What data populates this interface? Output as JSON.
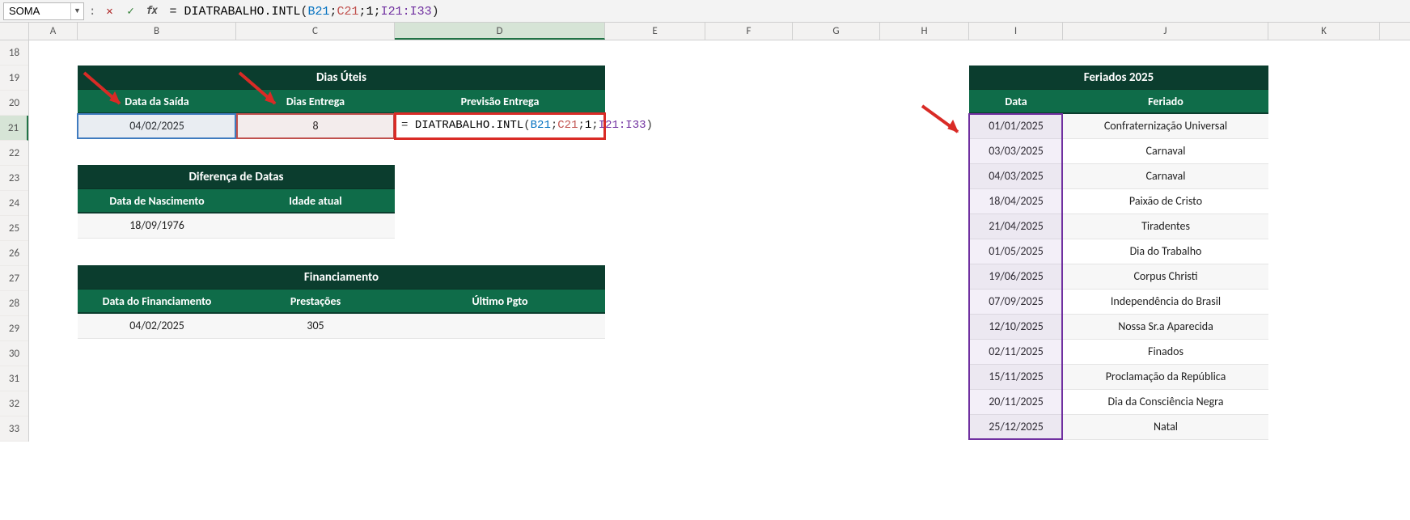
{
  "namebox_value": "SOMA",
  "formula": {
    "raw": "= DIATRABALHO.INTL(B21;C21;1;I21:I33)",
    "fn": "DIATRABALHO.INTL",
    "ref1": "B21",
    "ref2": "C21",
    "num": "1",
    "ref3": "I21:I33"
  },
  "cancel_glyph": "✕",
  "enter_glyph": "✓",
  "fx_glyph": "fx",
  "columns": [
    "A",
    "B",
    "C",
    "D",
    "E",
    "F",
    "G",
    "H",
    "I",
    "J",
    "K"
  ],
  "rows": [
    "18",
    "19",
    "20",
    "21",
    "22",
    "23",
    "24",
    "25",
    "26",
    "27",
    "28",
    "29",
    "30",
    "31",
    "32",
    "33"
  ],
  "dias_uteis": {
    "title": "Dias Úteis",
    "headers": {
      "b": "Data da Saída",
      "c": "Dias Entrega",
      "d": "Previsão Entrega"
    },
    "row": {
      "b": "04/02/2025",
      "c": "8",
      "d_formula": "= DIATRABALHO.INTL(B21;C21;1;I21:I33)"
    }
  },
  "diferenca": {
    "title": "Diferença de Datas",
    "headers": {
      "b": "Data de Nascimento",
      "c": "Idade atual"
    },
    "row": {
      "b": "18/09/1976",
      "c": ""
    }
  },
  "financiamento": {
    "title": "Financiamento",
    "headers": {
      "b": "Data do Financiamento",
      "c": "Prestações",
      "d": "Último Pgto"
    },
    "row": {
      "b": "04/02/2025",
      "c": "305",
      "d": ""
    }
  },
  "feriados": {
    "title": "Feriados 2025",
    "headers": {
      "i": "Data",
      "j": "Feriado"
    },
    "rows": [
      {
        "i": "01/01/2025",
        "j": "Confraternização Universal"
      },
      {
        "i": "03/03/2025",
        "j": "Carnaval"
      },
      {
        "i": "04/03/2025",
        "j": "Carnaval"
      },
      {
        "i": "18/04/2025",
        "j": "Paixão de Cristo"
      },
      {
        "i": "21/04/2025",
        "j": "Tiradentes"
      },
      {
        "i": "01/05/2025",
        "j": "Dia do Trabalho"
      },
      {
        "i": "19/06/2025",
        "j": "Corpus Christi"
      },
      {
        "i": "07/09/2025",
        "j": "Independência do Brasil"
      },
      {
        "i": "12/10/2025",
        "j": "Nossa Sr.a Aparecida"
      },
      {
        "i": "02/11/2025",
        "j": "Finados"
      },
      {
        "i": "15/11/2025",
        "j": "Proclamação da República"
      },
      {
        "i": "20/11/2025",
        "j": "Dia da Consciência Negra"
      },
      {
        "i": "25/12/2025",
        "j": "Natal"
      }
    ]
  }
}
